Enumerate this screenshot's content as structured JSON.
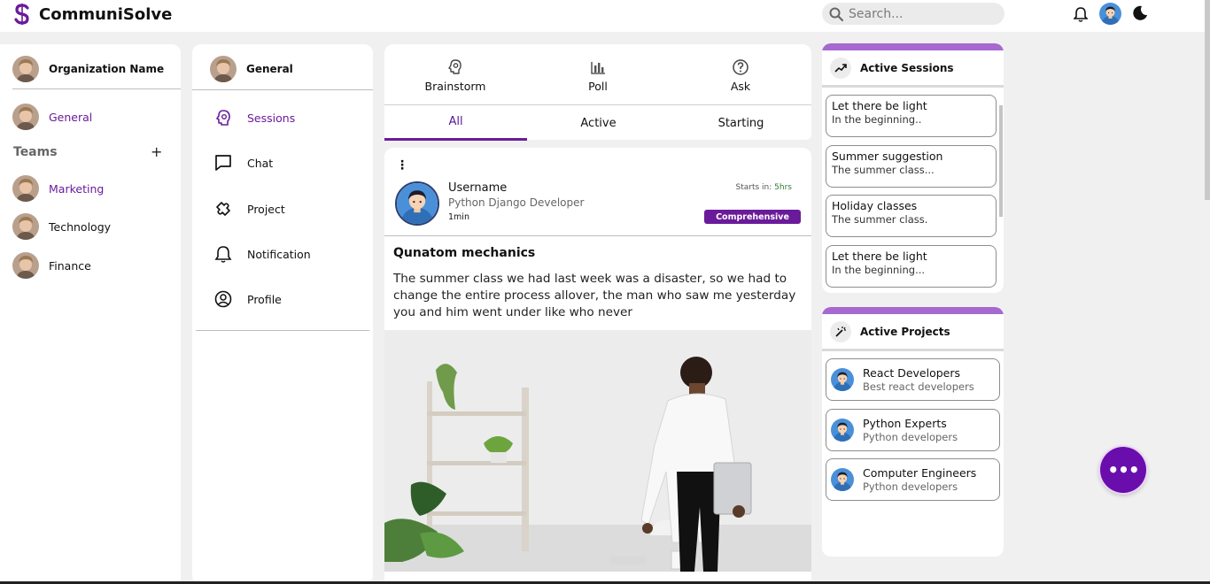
{
  "app": {
    "name": "CommuniSolve"
  },
  "search": {
    "placeholder": "Search..."
  },
  "theme": {
    "accent": "#6a1b9a",
    "accent_light": "#a569cf",
    "fab": "#6a0dad"
  },
  "topbar": {
    "icons": [
      "bell-icon",
      "user-avatar",
      "moon-icon"
    ]
  },
  "organization": {
    "name": "Organization Name",
    "items": [
      {
        "label": "General",
        "active": true
      }
    ],
    "teams_label": "Teams",
    "teams": [
      {
        "label": "Marketing",
        "active": true
      },
      {
        "label": "Technology",
        "active": false
      },
      {
        "label": "Finance",
        "active": false
      }
    ]
  },
  "channel": {
    "name": "General",
    "nav": [
      {
        "label": "Sessions",
        "icon": "brain-icon",
        "active": true
      },
      {
        "label": "Chat",
        "icon": "chat-icon",
        "active": false
      },
      {
        "label": "Project",
        "icon": "puzzle-icon",
        "active": false
      },
      {
        "label": "Notification",
        "icon": "bell-icon",
        "active": false
      },
      {
        "label": "Profile",
        "icon": "user-circle-icon",
        "active": false
      }
    ]
  },
  "create": {
    "actions": [
      {
        "label": "Brainstorm",
        "icon": "bulb-icon"
      },
      {
        "label": "Poll",
        "icon": "poll-icon"
      },
      {
        "label": "Ask",
        "icon": "question-icon"
      }
    ],
    "tabs": [
      {
        "label": "All",
        "active": true
      },
      {
        "label": "Active",
        "active": false
      },
      {
        "label": "Starting",
        "active": false
      }
    ]
  },
  "post": {
    "username": "Username",
    "role": "Python Django Developer",
    "time": "1min",
    "starts_label": "Starts in:",
    "starts_value": "5hrs",
    "badge": "Comprehensive",
    "title": "Qunatom mechanics",
    "body": "The summer class we had last week was a disaster, so we had to change the entire process allover, the man who saw me yesterday you and him went under like who never"
  },
  "active_sessions": {
    "title": "Active Sessions",
    "icon": "trending-up-icon",
    "items": [
      {
        "title": "Let there be light",
        "subtitle": "In the beginning.."
      },
      {
        "title": "Summer suggestion",
        "subtitle": "The summer class..."
      },
      {
        "title": "Holiday classes",
        "subtitle": "The summer class."
      },
      {
        "title": "Let there be light",
        "subtitle": "In the beginning..."
      }
    ]
  },
  "active_projects": {
    "title": "Active Projects",
    "icon": "wand-icon",
    "items": [
      {
        "title": "React Developers",
        "subtitle": "Best react developers"
      },
      {
        "title": "Python Experts",
        "subtitle": "Python developers"
      },
      {
        "title": "Computer Engineers",
        "subtitle": "Python developers"
      }
    ]
  },
  "fab": {
    "label": "•••"
  }
}
